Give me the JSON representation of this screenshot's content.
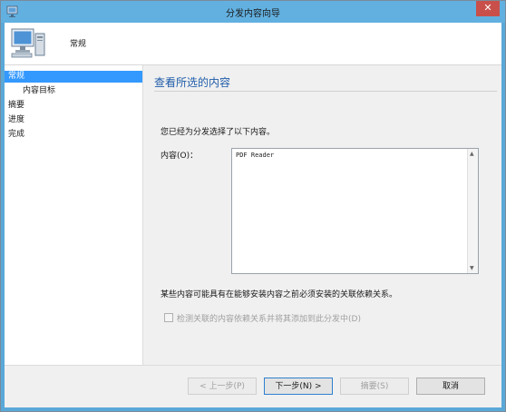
{
  "window": {
    "title": "分发内容向导",
    "close_glyph": "✕"
  },
  "header": {
    "title": "常规"
  },
  "nav": {
    "items": [
      {
        "label": "常规",
        "active": true,
        "sub": false
      },
      {
        "label": "内容目标",
        "active": false,
        "sub": true
      },
      {
        "label": "摘要",
        "active": false,
        "sub": false
      },
      {
        "label": "进度",
        "active": false,
        "sub": false
      },
      {
        "label": "完成",
        "active": false,
        "sub": false
      }
    ]
  },
  "main": {
    "heading": "查看所选的内容",
    "intro": "您已经为分发选择了以下内容。",
    "content_label": "内容(O)：",
    "content_items": [
      "PDF Reader"
    ],
    "note": "某些内容可能具有在能够安装内容之前必须安装的关联依赖关系。",
    "checkbox_label": "检测关联的内容依赖关系并将其添加到此分发中(D)",
    "checkbox_checked": false
  },
  "footer": {
    "prev": "< 上一步(P)",
    "next": "下一步(N) >",
    "summary": "摘要(S)",
    "cancel": "取消"
  },
  "colors": {
    "titlebar": "#62b0e0",
    "selection": "#3399ff",
    "heading": "#1e5ca8",
    "close": "#c9504a"
  }
}
